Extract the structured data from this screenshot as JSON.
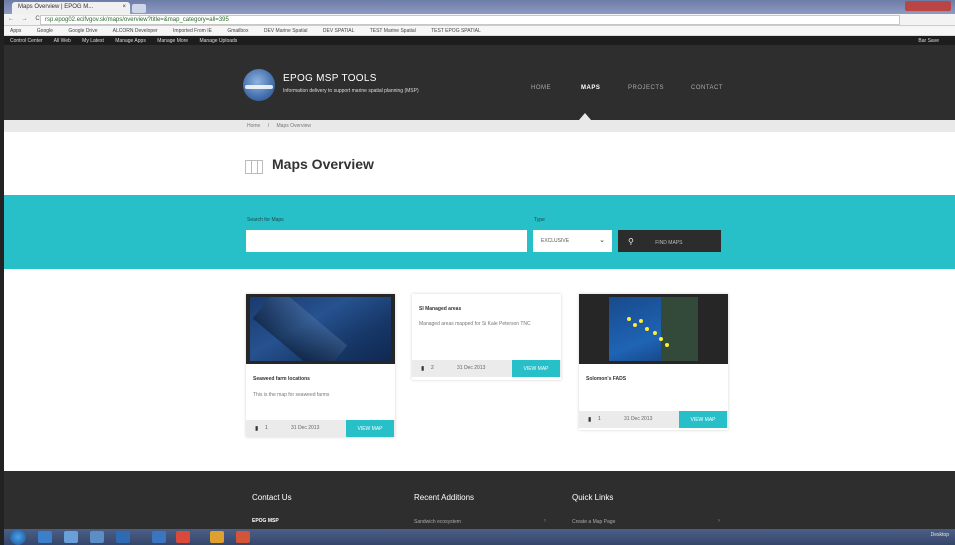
{
  "browser": {
    "tab_title": "Maps Overview | EPOG M...",
    "tab_close": "×",
    "nav_buttons": "← → C",
    "url": "rsp.epog02.ecifvgov.sk/maps/overview?title=&map_category=all=395",
    "bookmarks": [
      "Apps",
      "Google",
      "Google Drive",
      "ALCORN Developer",
      "Imported From IE",
      "Gmailbox",
      "DEV Marine Spatial",
      "DEV SPATIAL",
      "TEST Marine Spatial",
      "TEST EPOG SPATIAL"
    ],
    "extension_items": [
      "Control Center",
      "All Web",
      "My Latest",
      "Manage Apps",
      "Manage More",
      "Manage Uploads"
    ],
    "extension_right": "Bar Save"
  },
  "site": {
    "title": "EPOG MSP TOOLS",
    "tagline": "Information delivery to support marine spatial planning (MSP)",
    "nav": [
      {
        "label": "HOME",
        "active": false
      },
      {
        "label": "MAPS",
        "active": true
      },
      {
        "label": "PROJECTS",
        "active": false
      },
      {
        "label": "CONTACT",
        "active": false
      }
    ],
    "breadcrumbs": [
      "Home",
      "/",
      "Maps Overview"
    ]
  },
  "page": {
    "title": "Maps Overview"
  },
  "search": {
    "label": "Search for Maps",
    "value": "",
    "type_label": "Type",
    "type_value": "EXCLUSIVE",
    "type_chevron": "⌄",
    "find_icon": "⚲",
    "find_label": "FIND MAPS"
  },
  "cards": [
    {
      "title": "Seaweed farm locations",
      "desc": "This is the map for seaweed farms",
      "count": "1",
      "date": "31 Dec 2013",
      "view_label": "VIEW MAP"
    },
    {
      "title": "SI Managed areas",
      "desc": "Managed areas mapped for Si Kale Peterson TNC",
      "count": "2",
      "date": "31 Dec 2013",
      "view_label": "VIEW MAP"
    },
    {
      "title": "Solomon's FADS",
      "desc": "",
      "count": "1",
      "date": "31 Dec 2013",
      "view_label": "VIEW MAP"
    }
  ],
  "footer": {
    "contact_heading": "Contact Us",
    "contact_sub": "EPOG MSP",
    "recent_heading": "Recent Additions",
    "recent_link": "Sandwich ecosystem",
    "quick_heading": "Quick Links",
    "quick_link": "Create a Map Page",
    "arrow": "›"
  },
  "taskbar": {
    "tray_text": "Desktop"
  },
  "colors": {
    "accent": "#27bfc8",
    "header_bg": "#2e2e2e",
    "button_dark": "#2c2c2c"
  }
}
